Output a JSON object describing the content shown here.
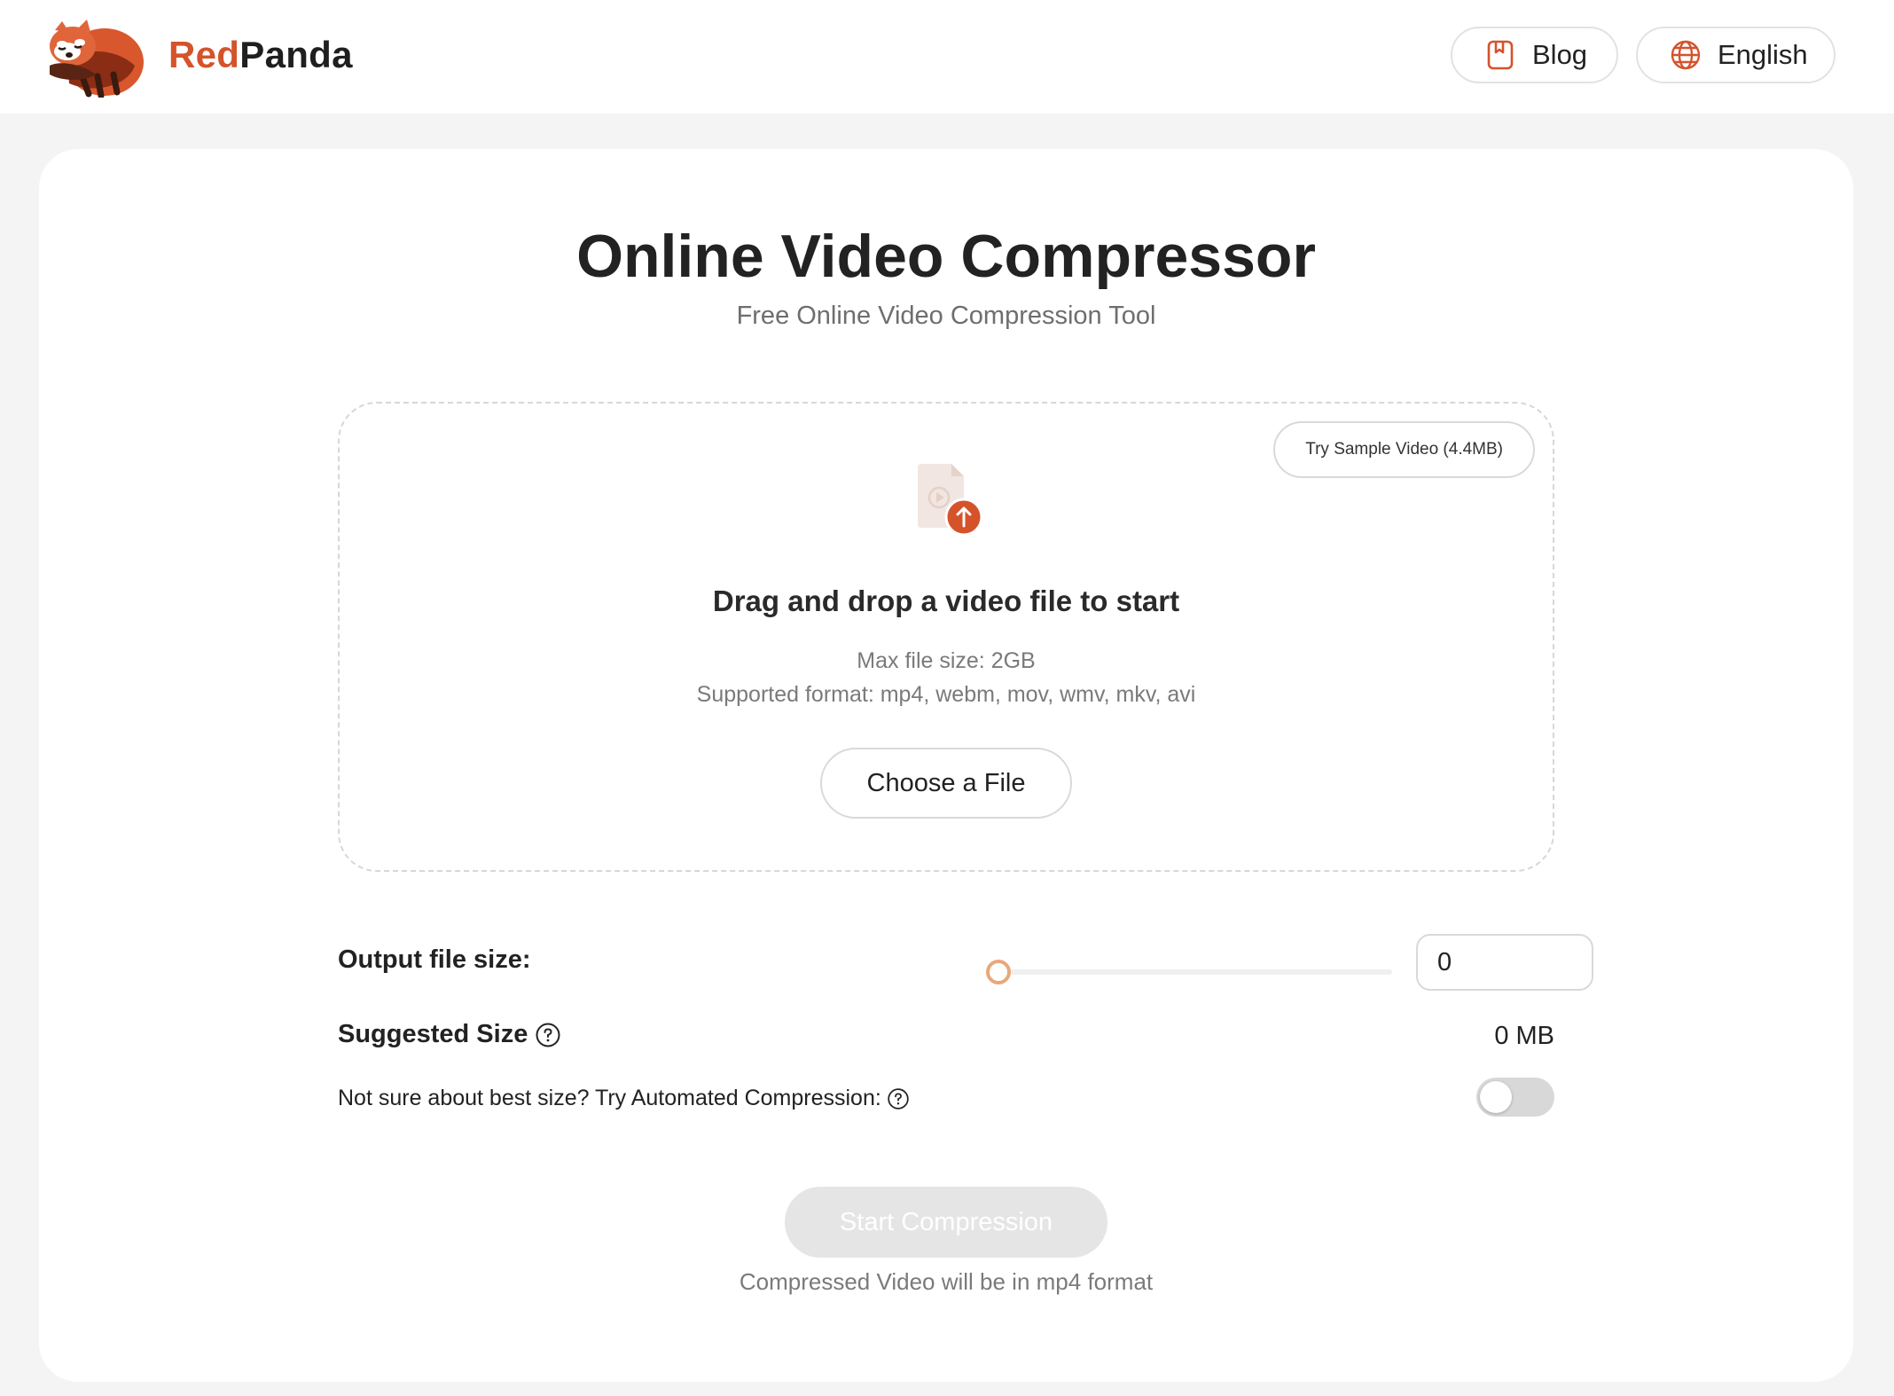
{
  "header": {
    "logo_text_red": "Red",
    "logo_text_dark": "Panda",
    "blog_label": "Blog",
    "language_label": "English"
  },
  "main": {
    "title": "Online Video Compressor",
    "subtitle": "Free Online Video Compression Tool"
  },
  "dropzone": {
    "sample_button": "Try Sample Video (4.4MB)",
    "heading": "Drag and drop a video file to start",
    "max_size": "Max file size: 2GB",
    "formats": "Supported format: mp4, webm, mov, wmv, mkv, avi",
    "choose_button": "Choose a File"
  },
  "settings": {
    "output_label": "Output file size:",
    "slider_value": 0,
    "output_value": "0",
    "suggested_label": "Suggested Size",
    "suggested_value": "0 MB",
    "auto_label": "Not sure about best size? Try Automated Compression:",
    "auto_enabled": false
  },
  "actions": {
    "start_button": "Start Compression",
    "format_note": "Compressed Video will be in mp4 format"
  },
  "colors": {
    "brand": "#d5532b",
    "slider_accent": "#e9a87a",
    "disabled_button": "#e5e5e5"
  },
  "icons": {
    "logo": "red-panda-logo",
    "blog": "bookmark-icon",
    "language": "globe-icon",
    "upload": "video-upload-icon",
    "help": "question-circle-icon"
  }
}
